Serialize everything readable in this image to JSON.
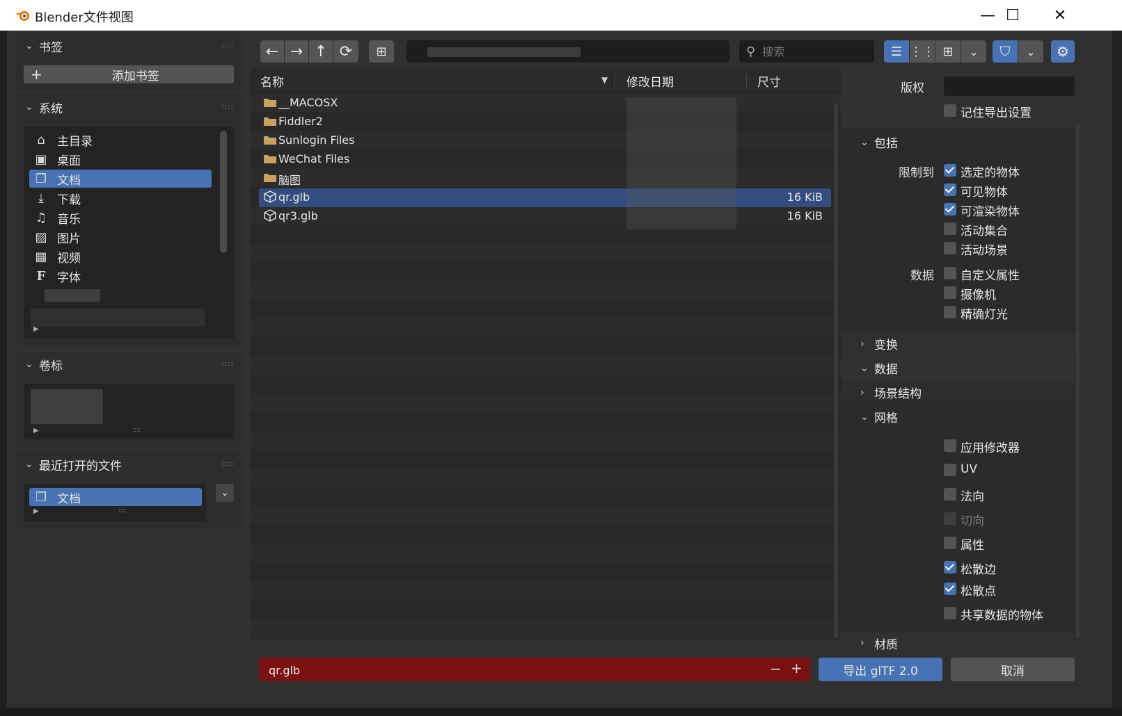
{
  "window": {
    "title": "Blender文件视图",
    "minimize": "—",
    "maximize": "☐",
    "close": "✕"
  },
  "bookmarks": {
    "header": "书签",
    "add_button": "添加书签",
    "add_icon": "+"
  },
  "system": {
    "header": "系统",
    "items": [
      {
        "label": "主目录",
        "icon": "home-icon"
      },
      {
        "label": "桌面",
        "icon": "desktop-icon"
      },
      {
        "label": "文档",
        "icon": "documents-icon"
      },
      {
        "label": "下载",
        "icon": "download-icon"
      },
      {
        "label": "音乐",
        "icon": "music-icon"
      },
      {
        "label": "图片",
        "icon": "image-icon"
      },
      {
        "label": "视频",
        "icon": "video-icon"
      },
      {
        "label": "字体",
        "icon": "font-icon"
      }
    ],
    "selected": "文档"
  },
  "volumes": {
    "header": "卷标"
  },
  "recent": {
    "header": "最近打开的文件",
    "items": [
      {
        "label": "文档",
        "icon": "documents-icon"
      }
    ]
  },
  "toolbar": {
    "search_placeholder": "搜索"
  },
  "filelist": {
    "columns": {
      "name": "名称",
      "date": "修改日期",
      "size": "尺寸"
    },
    "rows": [
      {
        "name": "__MACOSX",
        "type": "folder",
        "size": ""
      },
      {
        "name": "Fiddler2",
        "type": "folder",
        "size": ""
      },
      {
        "name": "Sunlogin Files",
        "type": "folder",
        "size": ""
      },
      {
        "name": "WeChat Files",
        "type": "folder",
        "size": ""
      },
      {
        "name": "脑图",
        "type": "folder",
        "size": ""
      },
      {
        "name": "qr.glb",
        "type": "mesh",
        "size": "16 KiB"
      },
      {
        "name": "qr3.glb",
        "type": "mesh",
        "size": "16 KiB"
      }
    ],
    "selected": "qr.glb"
  },
  "settings": {
    "copyright_label": "版权",
    "copyright_value": "",
    "remember": "记住导出设置",
    "include": {
      "header": "包括",
      "limit_label": "限制到",
      "selected": "选定的物体",
      "visible": "可见物体",
      "renderable": "可渲染物体",
      "active_collection": "活动集合",
      "active_scene": "活动场景",
      "data_label": "数据",
      "custom_props": "自定义属性",
      "cameras": "摄像机",
      "punctual_lights": "精确灯光"
    },
    "sections": {
      "transform": "变换",
      "data": "数据",
      "scene_graph": "场景结构",
      "mesh": "网格",
      "material": "材质"
    },
    "mesh": {
      "apply_modifiers": "应用修改器",
      "uv": "UV",
      "normals": "法向",
      "tangents": "切向",
      "attributes": "属性",
      "loose_edges": "松散边",
      "loose_points": "松散点",
      "shared_data": "共享数据的物体"
    }
  },
  "bottom": {
    "filename": "qr.glb",
    "minus": "−",
    "plus": "+",
    "export_button": "导出 glTF 2.0",
    "cancel_button": "取消"
  }
}
